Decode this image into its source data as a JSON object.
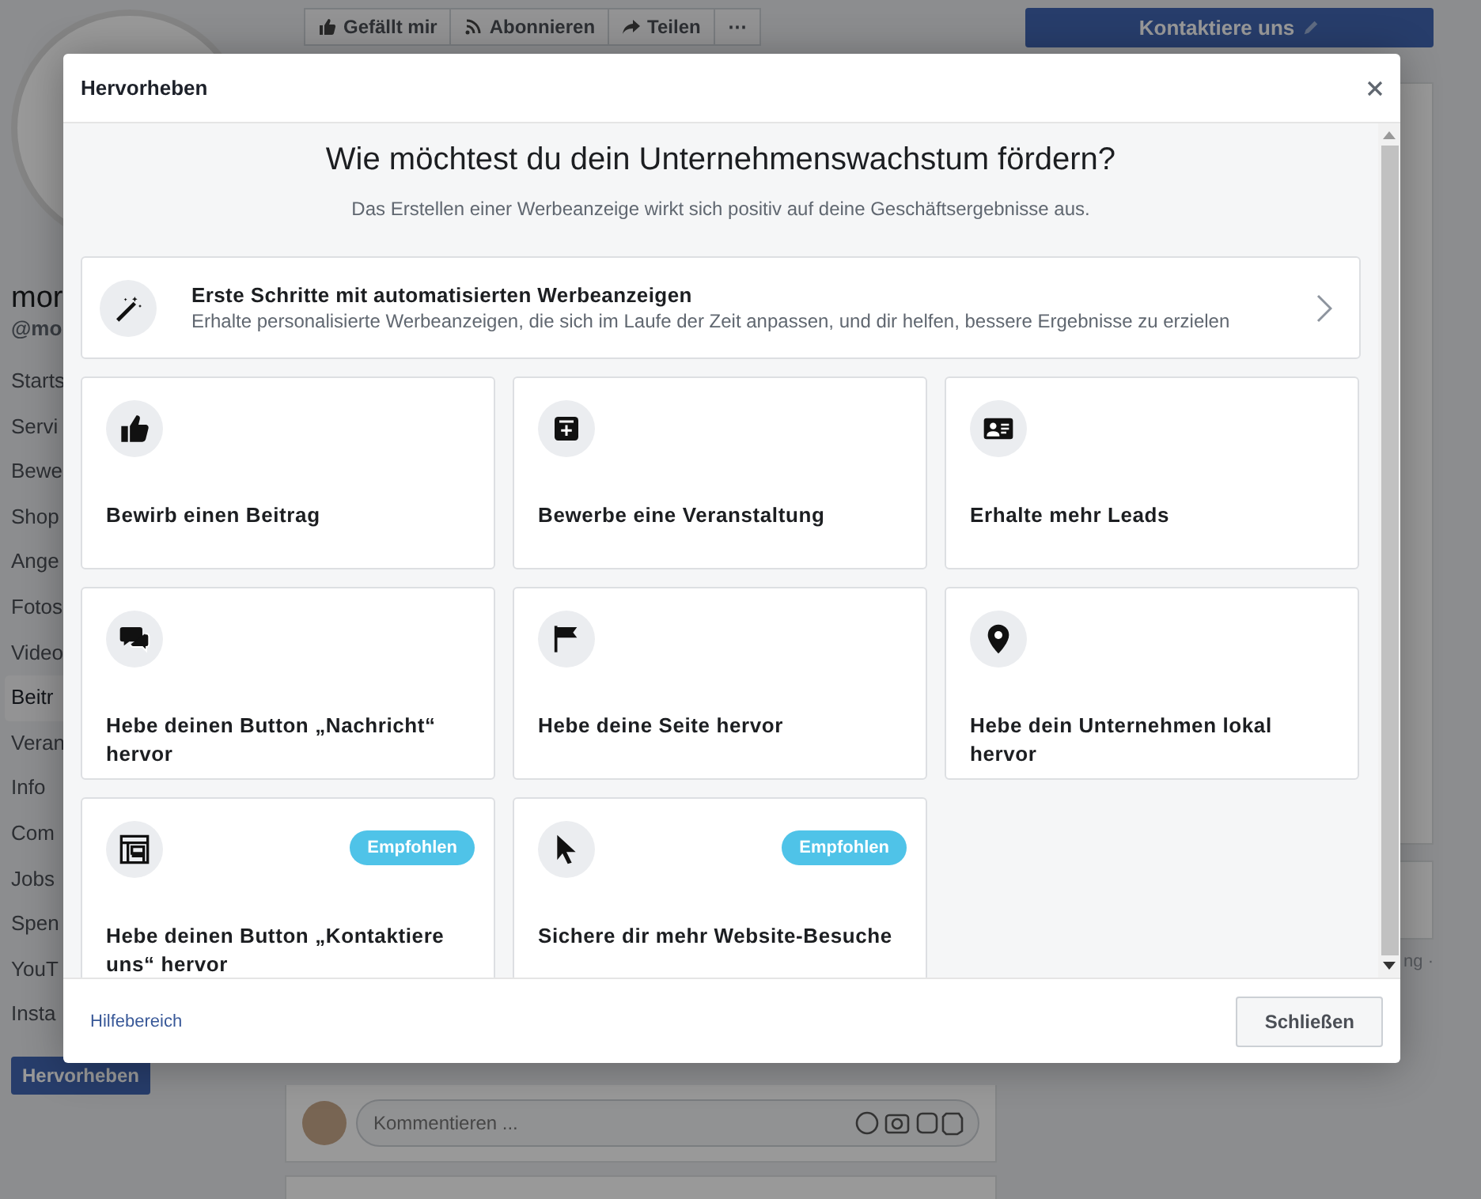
{
  "page": {
    "name": "mor",
    "handle": "@mo",
    "nav": [
      {
        "label": "Starts",
        "selected": false
      },
      {
        "label": "Servi",
        "selected": false
      },
      {
        "label": "Bewe",
        "selected": false
      },
      {
        "label": "Shop",
        "selected": false
      },
      {
        "label": "Ange",
        "selected": false
      },
      {
        "label": "Fotos",
        "selected": false
      },
      {
        "label": "Video",
        "selected": false
      },
      {
        "label": "Beitr",
        "selected": true
      },
      {
        "label": "Veran",
        "selected": false
      },
      {
        "label": "Info",
        "selected": false
      },
      {
        "label": "Com",
        "selected": false
      },
      {
        "label": "Jobs",
        "selected": false
      },
      {
        "label": "Spen",
        "selected": false
      },
      {
        "label": "YouT",
        "selected": false
      },
      {
        "label": "Insta",
        "selected": false
      }
    ],
    "promote_button": "Hervorheben",
    "actions": [
      {
        "kind": "like",
        "label": "Gefällt mir"
      },
      {
        "kind": "follow",
        "label": "Abonnieren"
      },
      {
        "kind": "share",
        "label": "Teilen"
      },
      {
        "kind": "more",
        "label": "⋯"
      }
    ],
    "contact_button": "Kontaktiere uns",
    "comment": {
      "placeholder": "Kommentieren ..."
    },
    "right_footer": "ng ·"
  },
  "dialog": {
    "title": "Hervorheben",
    "heading": "Wie möchtest du dein Unternehmenswachstum fördern?",
    "subheading": "Das Erstellen einer Werbeanzeige wirkt sich positiv auf deine Geschäftsergebnisse aus.",
    "featured": {
      "title": "Erste Schritte mit automatisierten Werbeanzeigen",
      "description": "Erhalte personalisierte Werbeanzeigen, die sich im Laufe der Zeit anpassen, und dir helfen, bessere Ergebnisse zu erzielen"
    },
    "options": [
      {
        "kind": "post",
        "label": "Bewirb einen Beitrag"
      },
      {
        "kind": "event",
        "label": "Bewerbe eine Veranstaltung"
      },
      {
        "kind": "leads",
        "label": "Erhalte mehr Leads"
      },
      {
        "kind": "message",
        "label": "Hebe deinen Button „Nachricht“ hervor"
      },
      {
        "kind": "page",
        "label": "Hebe deine Seite hervor"
      },
      {
        "kind": "local",
        "label": "Hebe dein Unternehmen lokal hervor"
      },
      {
        "kind": "cta",
        "label": "Hebe deinen Button „Kontaktiere uns“ hervor",
        "badge": "Empfohlen"
      },
      {
        "kind": "website",
        "label": "Sichere dir mehr Website-Besuche",
        "badge": "Empfohlen"
      }
    ],
    "help_link": "Hilfebereich",
    "close_button": "Schließen"
  }
}
